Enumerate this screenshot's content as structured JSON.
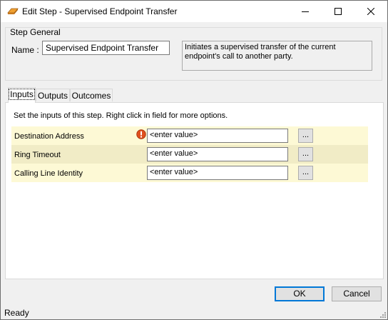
{
  "window": {
    "title": "Edit Step - Supervised Endpoint Transfer"
  },
  "step_general": {
    "legend": "Step General",
    "name_label": "Name :",
    "name_value": "Supervised Endpoint Transfer",
    "description": "Initiates a supervised transfer of the current endpoint's call to another party."
  },
  "tabs": [
    {
      "label": "Inputs",
      "active": true
    },
    {
      "label": "Outputs",
      "active": false
    },
    {
      "label": "Outcomes",
      "active": false
    }
  ],
  "inputs": {
    "instructions": "Set the inputs of this step.  Right click in field for more options.",
    "rows": [
      {
        "label": "Destination Address",
        "value": "<enter value>",
        "has_error": true,
        "button": "..."
      },
      {
        "label": "Ring Timeout",
        "value": "<enter value>",
        "has_error": false,
        "button": "..."
      },
      {
        "label": "Calling Line Identity",
        "value": "<enter value>",
        "has_error": false,
        "button": "..."
      }
    ]
  },
  "buttons": {
    "ok": "OK",
    "cancel": "Cancel"
  },
  "status": {
    "text": "Ready"
  },
  "colors": {
    "row_light": "#fdf9d5",
    "row_dark": "#f1ecc6",
    "error_icon": "#e0501f",
    "default_button_border": "#0078d7"
  }
}
